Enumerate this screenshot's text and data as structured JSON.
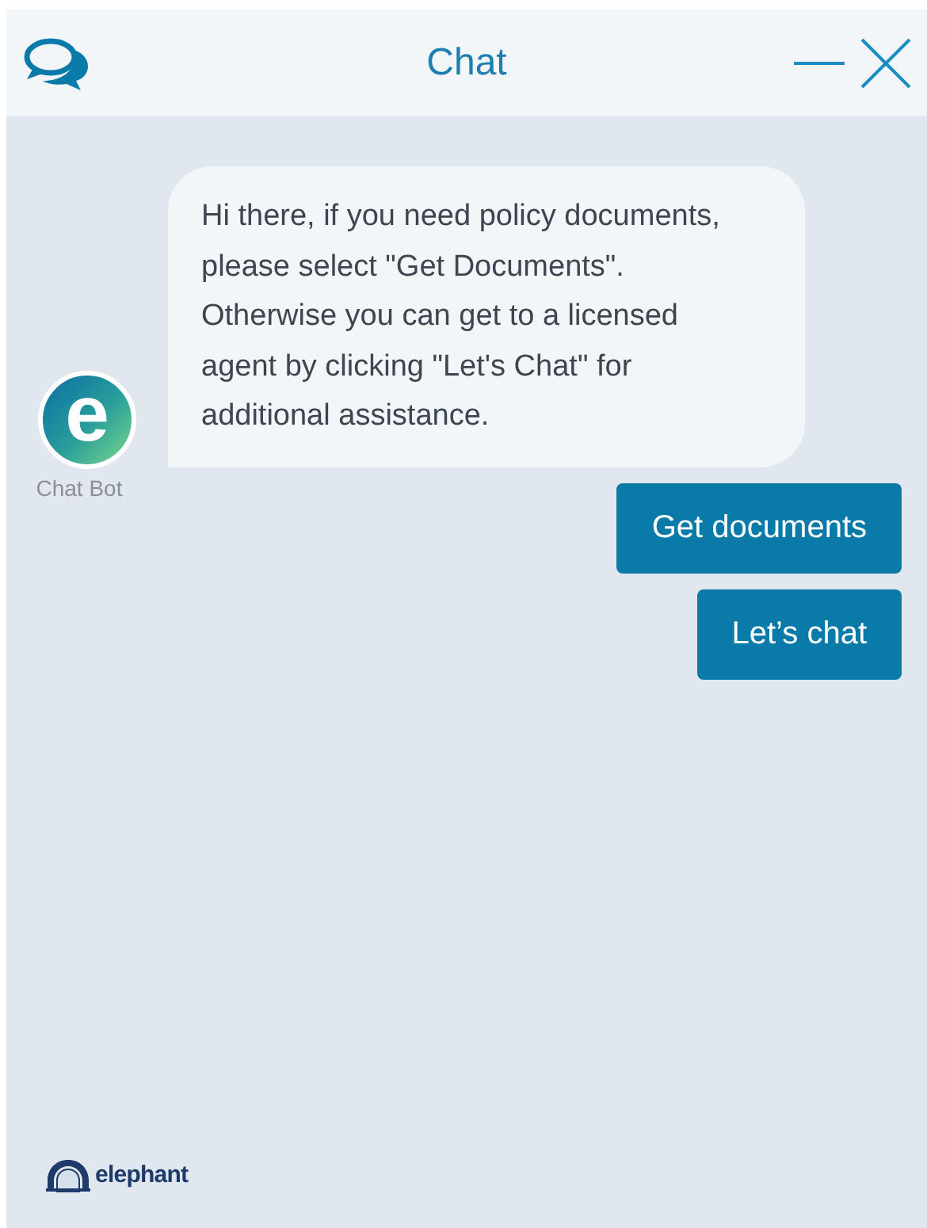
{
  "window": {
    "title": "Chat"
  },
  "messages": [
    {
      "sender": "Chat Bot",
      "avatar_letter": "e",
      "text": "Hi there, if you need policy documents, please select \"Get Documents\". Otherwise you can get to a licensed agent by clicking \"Let's Chat\" for additional assistance."
    }
  ],
  "quick_replies": [
    "Get documents",
    "Let’s chat"
  ],
  "footer": {
    "brand": "elephant"
  }
}
